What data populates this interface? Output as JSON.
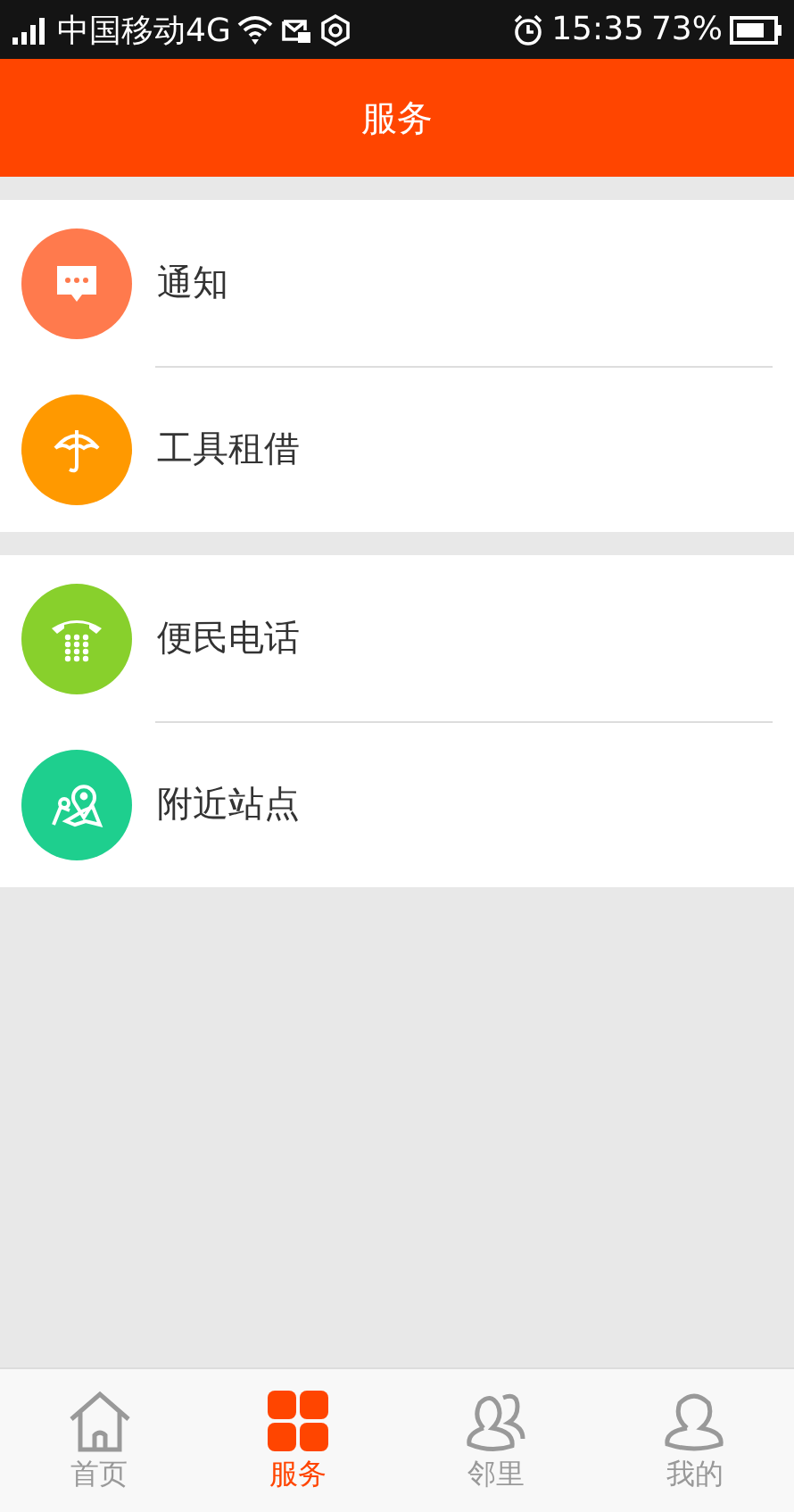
{
  "status_bar": {
    "carrier": "中国移动4G",
    "time": "15:35",
    "battery": "73%"
  },
  "header": {
    "title": "服务"
  },
  "sections": [
    {
      "items": [
        {
          "label": "通知",
          "kind": "message",
          "color": "#ff7a4d"
        },
        {
          "label": "工具租借",
          "kind": "umbrella",
          "color": "#ff9900"
        }
      ]
    },
    {
      "items": [
        {
          "label": "便民电话",
          "kind": "phone",
          "color": "#88d02c"
        },
        {
          "label": "附近站点",
          "kind": "map",
          "color": "#1ecf8e"
        }
      ]
    }
  ],
  "tabs": [
    {
      "label": "首页",
      "kind": "home",
      "selected": false
    },
    {
      "label": "服务",
      "kind": "grid",
      "selected": true
    },
    {
      "label": "邻里",
      "kind": "people",
      "selected": false
    },
    {
      "label": "我的",
      "kind": "person",
      "selected": false
    }
  ]
}
